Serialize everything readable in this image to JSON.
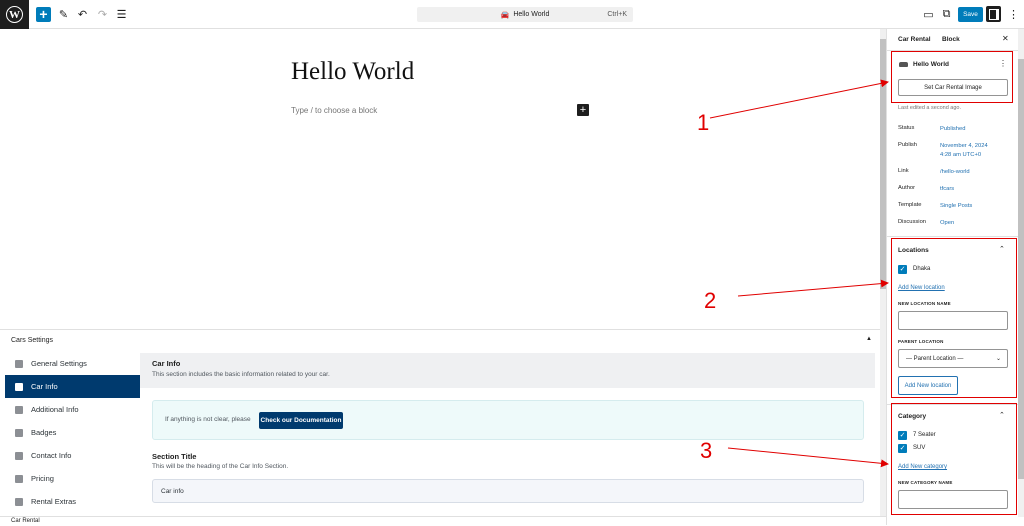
{
  "toolbar": {
    "doc_title": "Hello World",
    "shortcut": "Ctrl+K",
    "save_label": "Save"
  },
  "editor": {
    "post_title": "Hello World",
    "block_placeholder": "Type / to choose a block"
  },
  "meta": {
    "heading": "Cars Settings",
    "nav": [
      {
        "label": "General Settings"
      },
      {
        "label": "Car Info",
        "active": true
      },
      {
        "label": "Additional Info"
      },
      {
        "label": "Badges"
      },
      {
        "label": "Contact Info"
      },
      {
        "label": "Pricing"
      },
      {
        "label": "Rental Extras"
      }
    ],
    "section_header": {
      "title": "Car Info",
      "subtitle": "This section includes the basic information related to your car."
    },
    "notice": {
      "text": "If anything is not clear, please",
      "button": "Check our Documentation"
    },
    "section_title_label": "Section Title",
    "section_title_help": "This will be the heading of the Car Info Section.",
    "section_title_value": "Car info"
  },
  "bottom_label": "Car Rental",
  "sidebar": {
    "tabs": [
      "Car Rental",
      "Block"
    ],
    "post_name": "Hello World",
    "set_image_button": "Set Car Rental Image",
    "last_edited": "Last edited a second ago.",
    "rows": [
      {
        "key": "Status",
        "value": "Published"
      },
      {
        "key": "Publish",
        "value": "November 4, 2024\n4:28 am UTC+0"
      },
      {
        "key": "Link",
        "value": "/hello-world"
      },
      {
        "key": "Author",
        "value": "tfcars"
      },
      {
        "key": "Template",
        "value": "Single Posts"
      },
      {
        "key": "Discussion",
        "value": "Open"
      }
    ],
    "locations": {
      "title": "Locations",
      "items": [
        "Dhaka"
      ],
      "add_link": "Add New location",
      "name_label": "NEW LOCATION NAME",
      "parent_label": "PARENT LOCATION",
      "parent_value": "— Parent Location —",
      "add_button": "Add New location"
    },
    "category": {
      "title": "Category",
      "items": [
        "7 Seater",
        "SUV"
      ],
      "add_link": "Add New category",
      "name_label": "NEW CATEGORY NAME"
    }
  },
  "annotations": {
    "marks": [
      "1",
      "2",
      "3"
    ],
    "color": "#e00000"
  }
}
